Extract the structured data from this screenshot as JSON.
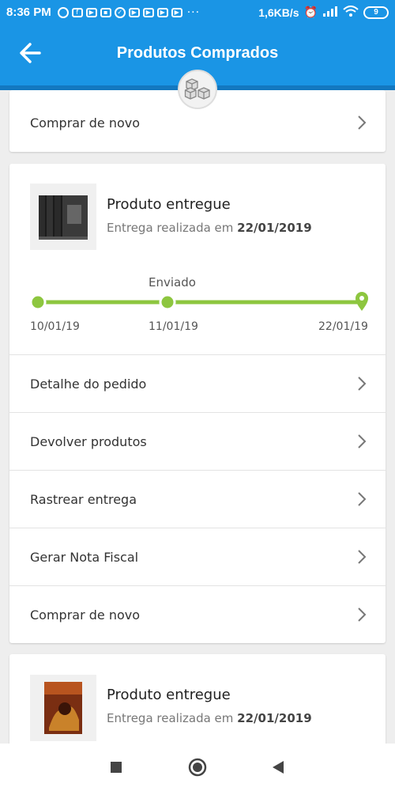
{
  "status_bar": {
    "time": "8:36 PM",
    "network_speed": "1,6KB/s",
    "battery": "9"
  },
  "header": {
    "title": "Produtos Comprados",
    "back_icon": "arrow-left-icon",
    "badge_icon": "boxes-icon"
  },
  "top_card": {
    "row_label": "Comprar de novo"
  },
  "order1": {
    "status": "Produto entregue",
    "delivery_prefix": "Entrega realizada em ",
    "delivery_date": "22/01/2019",
    "timeline": {
      "middle_label": "Enviado",
      "dates": [
        "10/01/19",
        "11/01/19",
        "22/01/19"
      ]
    },
    "actions": [
      {
        "label": "Detalhe do pedido"
      },
      {
        "label": "Devolver produtos"
      },
      {
        "label": "Rastrear entrega"
      },
      {
        "label": "Gerar Nota Fiscal"
      },
      {
        "label": "Comprar de novo"
      }
    ]
  },
  "order2": {
    "status": "Produto entregue",
    "delivery_prefix": "Entrega realizada em ",
    "delivery_date": "22/01/2019"
  },
  "colors": {
    "primary": "#1a95e5",
    "timeline": "#8dc63f"
  }
}
